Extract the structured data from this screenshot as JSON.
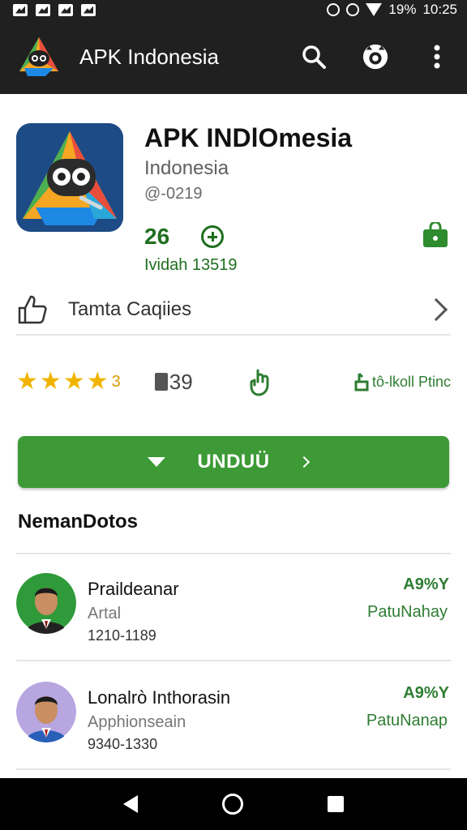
{
  "status_bar": {
    "battery": "19%",
    "time": "10:25"
  },
  "app_bar": {
    "title": "APK Indonesia"
  },
  "app": {
    "name": "APK INDlOmesia",
    "developer": "Indonesia",
    "version": "@-0219",
    "stat_number": "26",
    "stat_line": "Ividah  13519"
  },
  "category_row": {
    "label": "Tamta Caqiies"
  },
  "info_row": {
    "rating_suffix": "3",
    "rating_value": 3.5,
    "downloads": "39",
    "rank_label": "tô-lkoll Ptinc"
  },
  "download_button": {
    "label": "UNDUÜ"
  },
  "reviews_section": {
    "title": "NemanDotos",
    "items": [
      {
        "name": "Praildeanar",
        "subtitle": "Artal",
        "date": "1210-1189",
        "score": "A9%Y",
        "tag": "PatuNahay"
      },
      {
        "name": "Lonalrò Inthorasin",
        "subtitle": "Apphionseain",
        "date": "9340-1330",
        "score": "A9%Y",
        "tag": "PatuNanap"
      }
    ]
  },
  "colors": {
    "accent_green": "#3d9a36",
    "dark_bar": "#202020",
    "star": "#f0b400"
  }
}
